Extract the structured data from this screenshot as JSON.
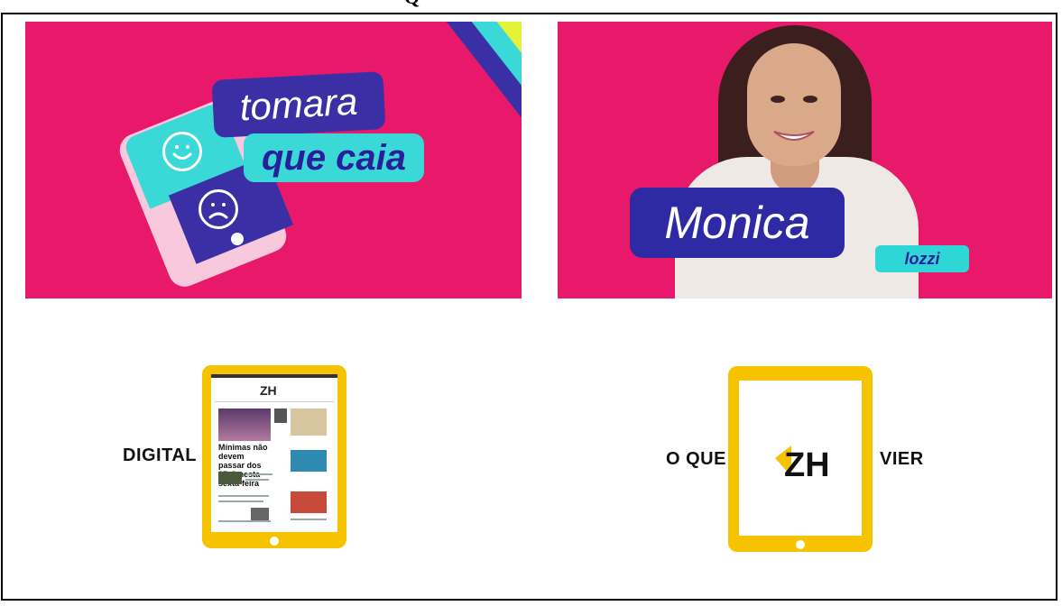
{
  "top_glyph": "Q",
  "panel1": {
    "title_line1": "tomara",
    "title_line2": "que caia",
    "colors": {
      "background": "#e8196a",
      "cyan": "#3ad9d8",
      "purple": "#3b2fa6",
      "yellow": "#e5f23a"
    },
    "icons": [
      "smile-face-icon",
      "sad-face-icon",
      "phone-icon"
    ]
  },
  "panel2": {
    "name_first": "Monica",
    "name_last": "lozzi",
    "colors": {
      "background": "#e8196a",
      "name_box": "#2d2aa3",
      "surname_box": "#2fd6d6"
    }
  },
  "tablet_left": {
    "label": "DIGITAL",
    "screen": {
      "logo": "ZH",
      "headline": "Mínimas não devem passar dos 25°C nesta sexta-feira"
    },
    "color": "#f7c300"
  },
  "tablet_right": {
    "label_left": "O QUE",
    "label_right": "VIER",
    "logo": "ZH",
    "color": "#f7c300"
  }
}
